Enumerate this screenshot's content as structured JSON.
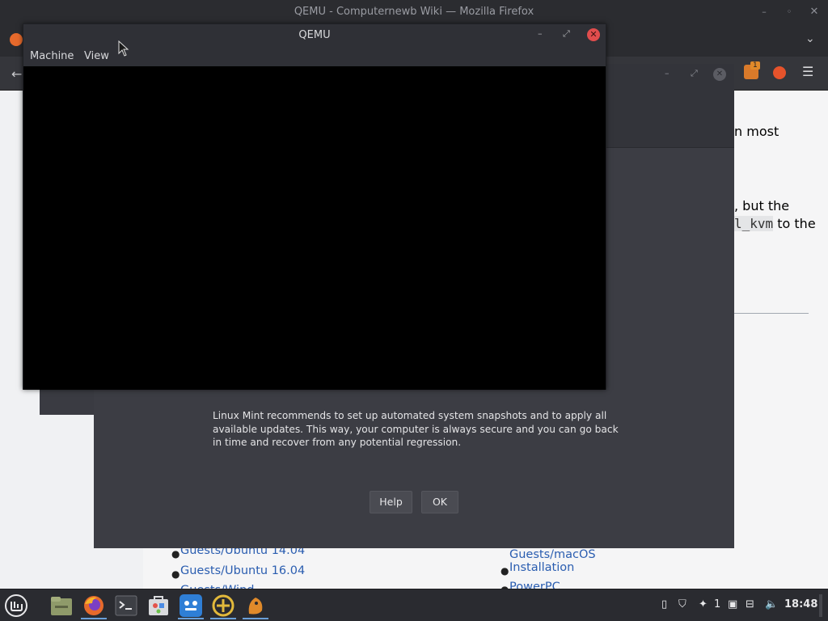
{
  "firefox": {
    "window_title": "QEMU - Computernewb Wiki — Mozilla Firefox",
    "wiki_fragments": {
      "line1": "n most",
      "line2": ", but the",
      "line3_code": "l_kvm",
      "line3_text": " to the"
    },
    "links_left": [
      "Guests/Ubuntu 14.04",
      "Guests/Ubuntu 16.04",
      "Guests/Wind..."
    ],
    "links_right": [
      "Guests/macOS",
      "Installation",
      "PowerPC"
    ],
    "toolbar_badge": "1"
  },
  "mint_dialog": {
    "message": "Linux Mint recommends to set up automated system snapshots and to apply all available updates. This way, your computer is always secure and you can go back in time and recover from any potential regression.",
    "help_label": "Help",
    "ok_label": "OK"
  },
  "qemu": {
    "title": "QEMU",
    "menu": [
      "Machine",
      "View"
    ]
  },
  "taskbar": {
    "apps": [
      "menu-icon",
      "files-icon",
      "firefox-icon",
      "terminal-icon",
      "software-manager-icon",
      "qemu-icon",
      "update-manager-icon",
      "app-icon"
    ],
    "tray_workspace": "1",
    "clock": "18:48"
  },
  "colors": {
    "link": "#2a5db0",
    "close": "#e14d4d",
    "accent": "#6a9fd8"
  }
}
